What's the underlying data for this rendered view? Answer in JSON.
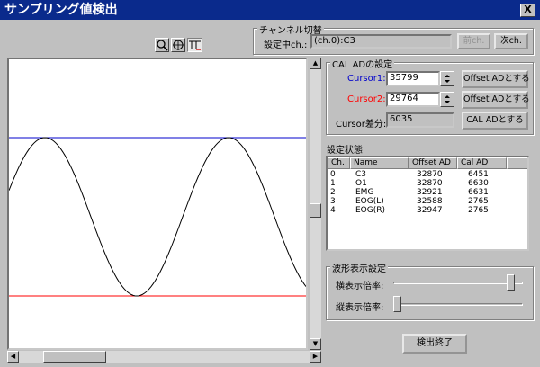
{
  "window": {
    "title": "サンプリング値検出",
    "close_label": "X"
  },
  "toolbar": {
    "icons": [
      "zoom-icon",
      "target-icon",
      "cursor-mode-icon"
    ]
  },
  "channel_switch": {
    "group_label": "チャンネル切替",
    "current_label": "設定中ch.:",
    "current_value": "(ch.0):C3",
    "prev_label": "前ch.",
    "next_label": "次ch."
  },
  "cal_settings": {
    "group_label": "CAL ADの設定",
    "cursor1_label": "Cursor1:",
    "cursor1_value": "35799",
    "cursor2_label": "Cursor2:",
    "cursor2_value": "29764",
    "diff_label": "Cursor差分:",
    "diff_value": "6035",
    "offset_btn1": "Offset ADとする",
    "offset_btn2": "Offset ADとする",
    "cal_btn": "CAL ADとする",
    "cursor1_color": "#0000cc",
    "cursor2_color": "#ff0000"
  },
  "status": {
    "label": "設定状態",
    "columns": [
      "Ch.",
      "Name",
      "Offset AD",
      "Cal AD"
    ],
    "rows": [
      [
        "0",
        "C3",
        "32870",
        "6451"
      ],
      [
        "1",
        "O1",
        "32870",
        "6630"
      ],
      [
        "2",
        "EMG",
        "32921",
        "6631"
      ],
      [
        "3",
        "EOG(L)",
        "32588",
        "2765"
      ],
      [
        "4",
        "EOG(R)",
        "32947",
        "2765"
      ]
    ]
  },
  "waveform": {
    "group_label": "波形表示設定",
    "h_zoom_label": "横表示倍率:",
    "v_zoom_label": "縦表示倍率:",
    "h_zoom_level": 0.9,
    "v_zoom_level": 0.03
  },
  "finish_label": "検出終了"
}
